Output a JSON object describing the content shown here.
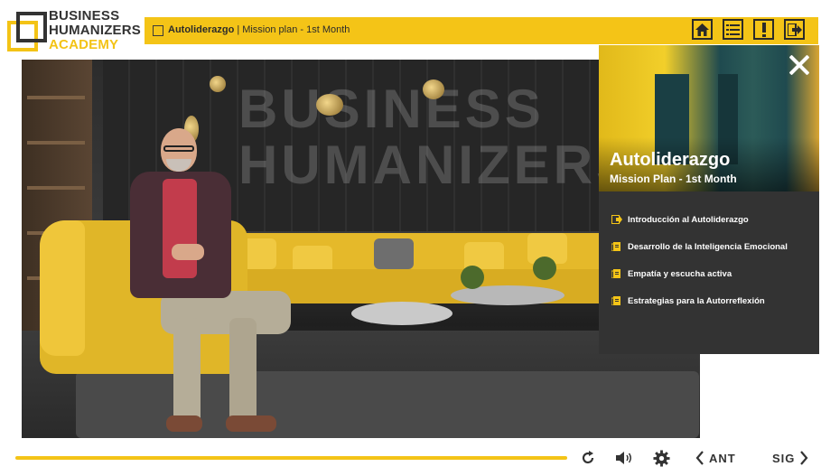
{
  "logo": {
    "line1": "BUSINESS",
    "line2": "HUMANIZERS",
    "line3": "ACADEMY"
  },
  "topbar": {
    "course": "Autoliderazgo",
    "separator": "|",
    "lesson": "Mission plan - 1st Month",
    "buttons": [
      "home-icon",
      "list-icon",
      "alert-icon",
      "exit-icon"
    ]
  },
  "scene": {
    "watermark_line1": "BUSINESS",
    "watermark_line2": "HUMANIZERS"
  },
  "panel": {
    "title": "Autoliderazgo",
    "subtitle": "Mission Plan - 1st Month",
    "items": [
      {
        "label": "Introducción al Autoliderazgo",
        "icon": "active-arrow-icon"
      },
      {
        "label": "Desarrollo de la Inteligencia Emocional",
        "icon": "document-icon"
      },
      {
        "label": "Empatía y escucha activa",
        "icon": "document-icon"
      },
      {
        "label": "Estrategias para la Autorreflexión",
        "icon": "document-icon"
      }
    ]
  },
  "controls": {
    "prev_label": "ANT",
    "next_label": "SIG"
  },
  "colors": {
    "accent": "#f4c417",
    "panel_bg": "#333333",
    "dark": "#2a2a2a"
  }
}
